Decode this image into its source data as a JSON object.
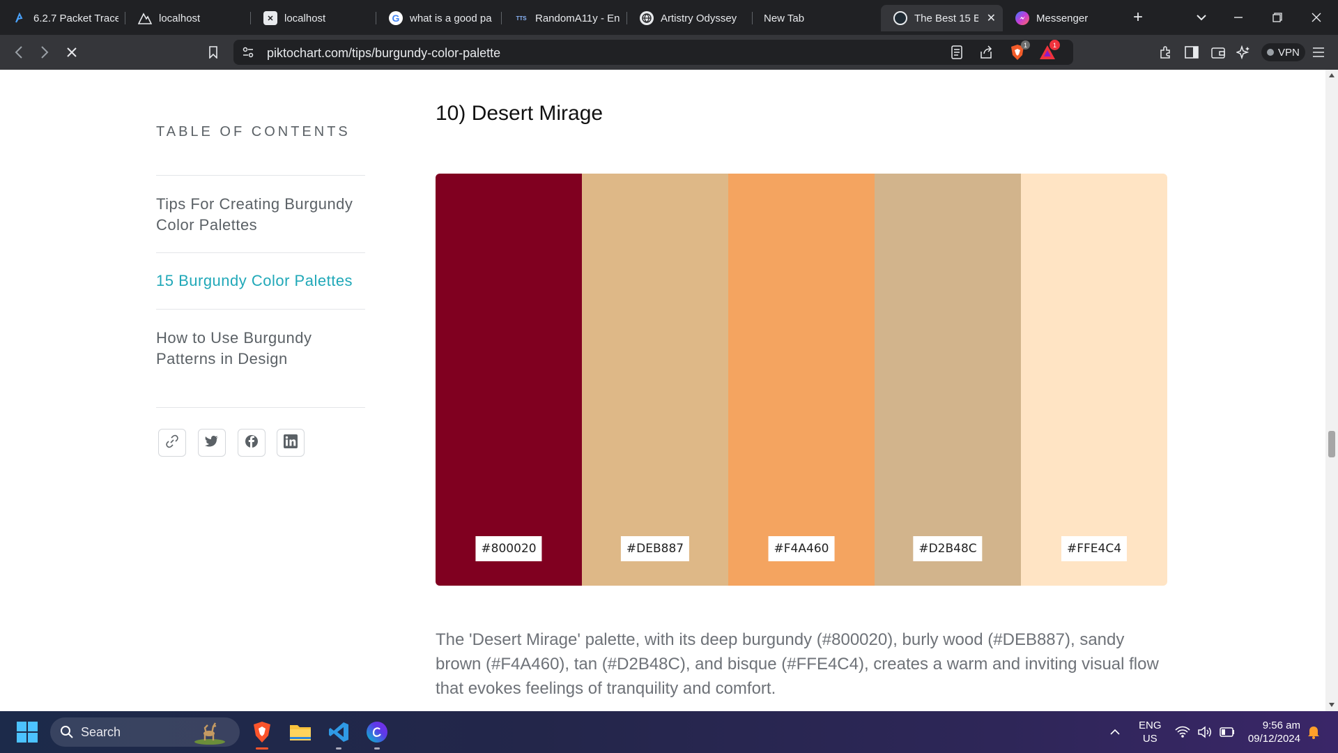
{
  "tabs": [
    {
      "title": "6.2.7 Packet Trace",
      "icon": "packet-tracer-icon"
    },
    {
      "title": "localhost",
      "icon": "mountain-icon"
    },
    {
      "title": "localhost",
      "icon": "xampp-icon"
    },
    {
      "title": "what is a good pa",
      "icon": "google-icon"
    },
    {
      "title": "RandomA11y - En",
      "icon": "tts-icon"
    },
    {
      "title": "Artistry Odyssey",
      "icon": "globe-icon"
    },
    {
      "title": "New Tab",
      "icon": ""
    },
    {
      "title": "The Best 15 B",
      "icon": "piktochart-icon",
      "active": true
    },
    {
      "title": "Messenger",
      "icon": "messenger-icon"
    }
  ],
  "address_bar": {
    "url": "piktochart.com/tips/burgundy-color-palette",
    "shield_badge": "1",
    "alert_badge": "1",
    "vpn_label": "VPN"
  },
  "toc": {
    "heading": "TABLE OF CONTENTS",
    "items": [
      {
        "label": "Tips For Creating Burgundy Color Palettes",
        "active": false
      },
      {
        "label": "15 Burgundy Color Palettes",
        "active": true
      },
      {
        "label": "How to Use Burgundy Patterns in Design",
        "active": false
      }
    ],
    "share_icons": [
      "link-icon",
      "twitter-icon",
      "facebook-icon",
      "linkedin-icon"
    ]
  },
  "section": {
    "title": "10) Desert Mirage",
    "swatches": [
      {
        "hex": "#800020",
        "color": "#800020"
      },
      {
        "hex": "#DEB887",
        "color": "#DEB887"
      },
      {
        "hex": "#F4A460",
        "color": "#F4A460"
      },
      {
        "hex": "#D2B48C",
        "color": "#D2B48C"
      },
      {
        "hex": "#FFE4C4",
        "color": "#FFE4C4"
      }
    ],
    "description": "The 'Desert Mirage' palette, with its deep burgundy (#800020), burly wood (#DEB887), sandy brown (#F4A460), tan (#D2B48C), and bisque (#FFE4C4), creates a warm and inviting visual flow that evokes feelings of tranquility and comfort."
  },
  "taskbar": {
    "search_placeholder": "Search",
    "apps": [
      "brave-icon",
      "file-explorer-icon",
      "vscode-icon",
      "canva-icon"
    ],
    "lang_top": "ENG",
    "lang_bottom": "US",
    "time": "9:56 am",
    "date": "09/12/2024"
  },
  "colors": {
    "accent": "#20a8b8",
    "toc_text": "#5b6166"
  }
}
